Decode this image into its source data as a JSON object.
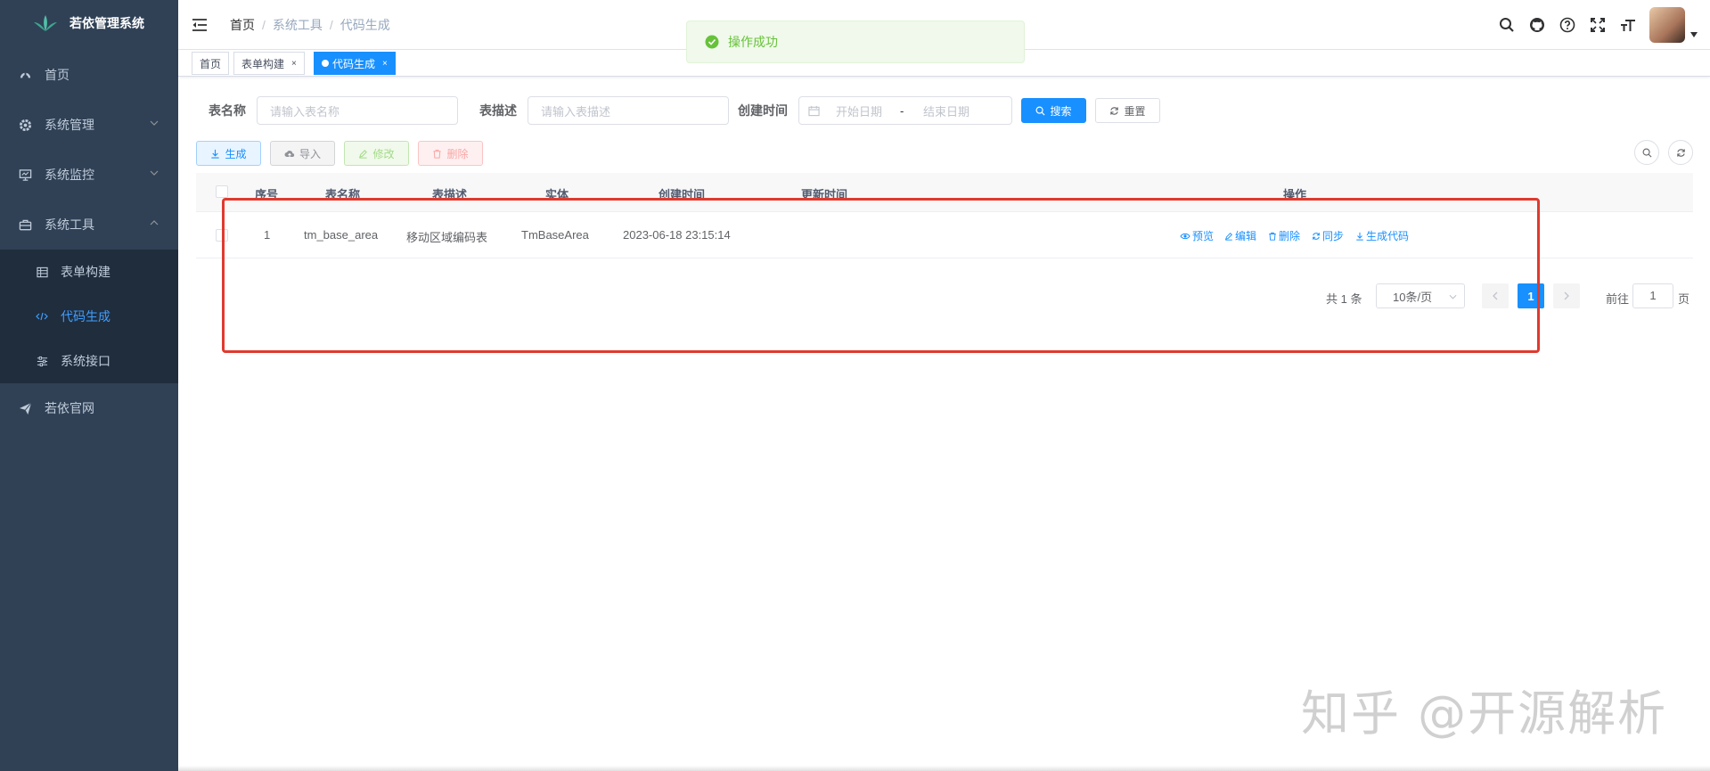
{
  "app": {
    "title": "若依管理系统"
  },
  "sidebar": {
    "items": [
      {
        "label": "首页",
        "icon": "dashboard-icon"
      },
      {
        "label": "系统管理",
        "icon": "gear-icon"
      },
      {
        "label": "系统监控",
        "icon": "monitor-icon"
      },
      {
        "label": "系统工具",
        "icon": "toolbox-icon"
      },
      {
        "label": "若依官网",
        "icon": "paper-plane-icon"
      }
    ],
    "subitems": [
      {
        "label": "表单构建",
        "icon": "table-icon"
      },
      {
        "label": "代码生成",
        "icon": "code-icon",
        "active": true
      },
      {
        "label": "系统接口",
        "icon": "sliders-icon"
      }
    ]
  },
  "breadcrumb": [
    "首页",
    "系统工具",
    "代码生成"
  ],
  "tabs": [
    {
      "label": "首页"
    },
    {
      "label": "表单构建",
      "close": "×"
    },
    {
      "label": "代码生成",
      "close": "×",
      "active": true
    }
  ],
  "toast": {
    "message": "操作成功"
  },
  "search": {
    "table_name_label": "表名称",
    "table_name_placeholder": "请输入表名称",
    "table_desc_label": "表描述",
    "table_desc_placeholder": "请输入表描述",
    "create_time_label": "创建时间",
    "start_placeholder": "开始日期",
    "range_sep": "-",
    "end_placeholder": "结束日期",
    "search_btn": "搜索",
    "reset_btn": "重置"
  },
  "toolbar": {
    "generate": "生成",
    "import": "导入",
    "edit": "修改",
    "delete": "删除"
  },
  "table": {
    "headers": {
      "index": "序号",
      "table_name": "表名称",
      "table_desc": "表描述",
      "entity": "实体",
      "create_time": "创建时间",
      "update_time": "更新时间",
      "actions": "操作"
    },
    "rows": [
      {
        "index": "1",
        "table_name": "tm_base_area",
        "table_desc": "移动区域编码表",
        "entity": "TmBaseArea",
        "create_time": "2023-06-18 23:15:14",
        "update_time": ""
      }
    ],
    "actions": {
      "preview": "预览",
      "edit": "编辑",
      "delete": "删除",
      "sync": "同步",
      "gen_code": "生成代码"
    }
  },
  "pagination": {
    "total": "共 1 条",
    "page_size": "10条/页",
    "current": "1",
    "goto_label": "前往",
    "goto_value": "1",
    "page_suffix": "页"
  },
  "watermark": "知乎 @开源解析",
  "colors": {
    "sidebar_bg": "#304156",
    "primary": "#1890ff",
    "success": "#67c23a",
    "highlight": "#e03a2f"
  }
}
